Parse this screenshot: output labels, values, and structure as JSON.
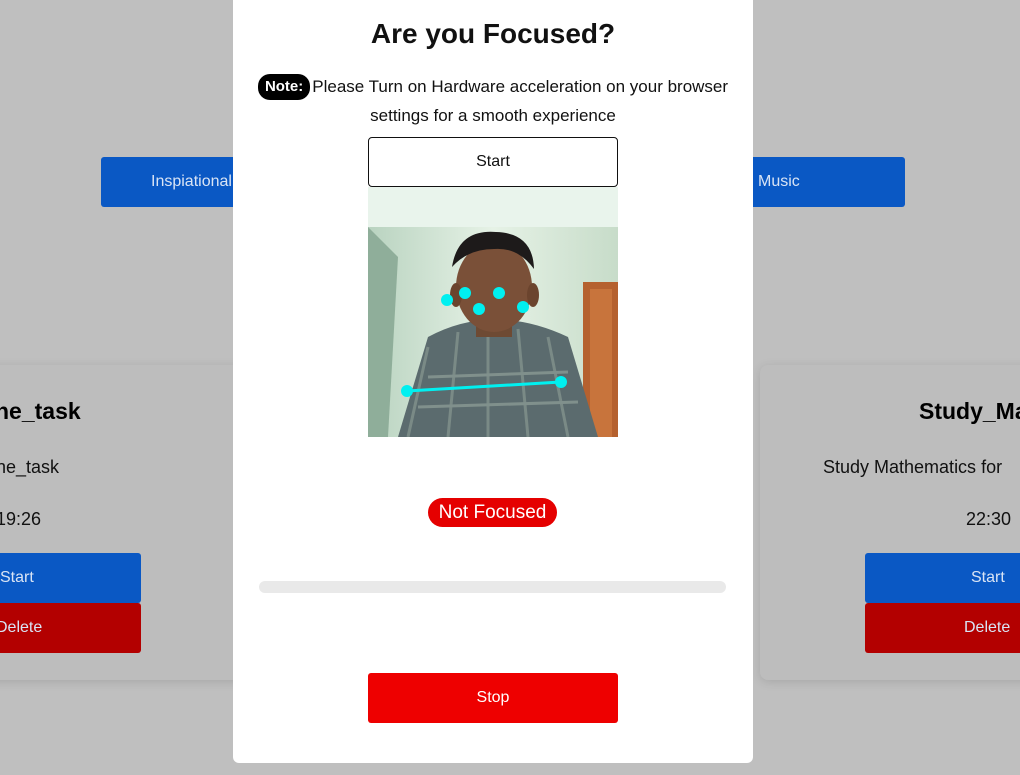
{
  "background": {
    "nav_buttons": [
      {
        "label": "Inspiational"
      },
      {
        "label": "Music"
      }
    ],
    "cards": [
      {
        "title": "ne_task",
        "description": "ne_task",
        "time": "19:26",
        "start_label": "Start",
        "delete_label": "Delete"
      },
      {
        "title": "Study_Ma",
        "description": "Study Mathematics for",
        "time": "22:30",
        "start_label": "Start",
        "delete_label": "Delete"
      }
    ]
  },
  "modal": {
    "title": "Are you Focused?",
    "note_badge": "Note:",
    "note_text": "Please Turn on Hardware acceleration on your browser settings for a smooth experience",
    "start_label": "Start",
    "status": "Not Focused",
    "progress_fraction": 0.0,
    "stop_label": "Stop"
  },
  "colors": {
    "primary_blue": "#0a58c4",
    "danger_red": "#e50000",
    "delete_red": "#b30000",
    "landmark_cyan": "#00f0f0"
  }
}
